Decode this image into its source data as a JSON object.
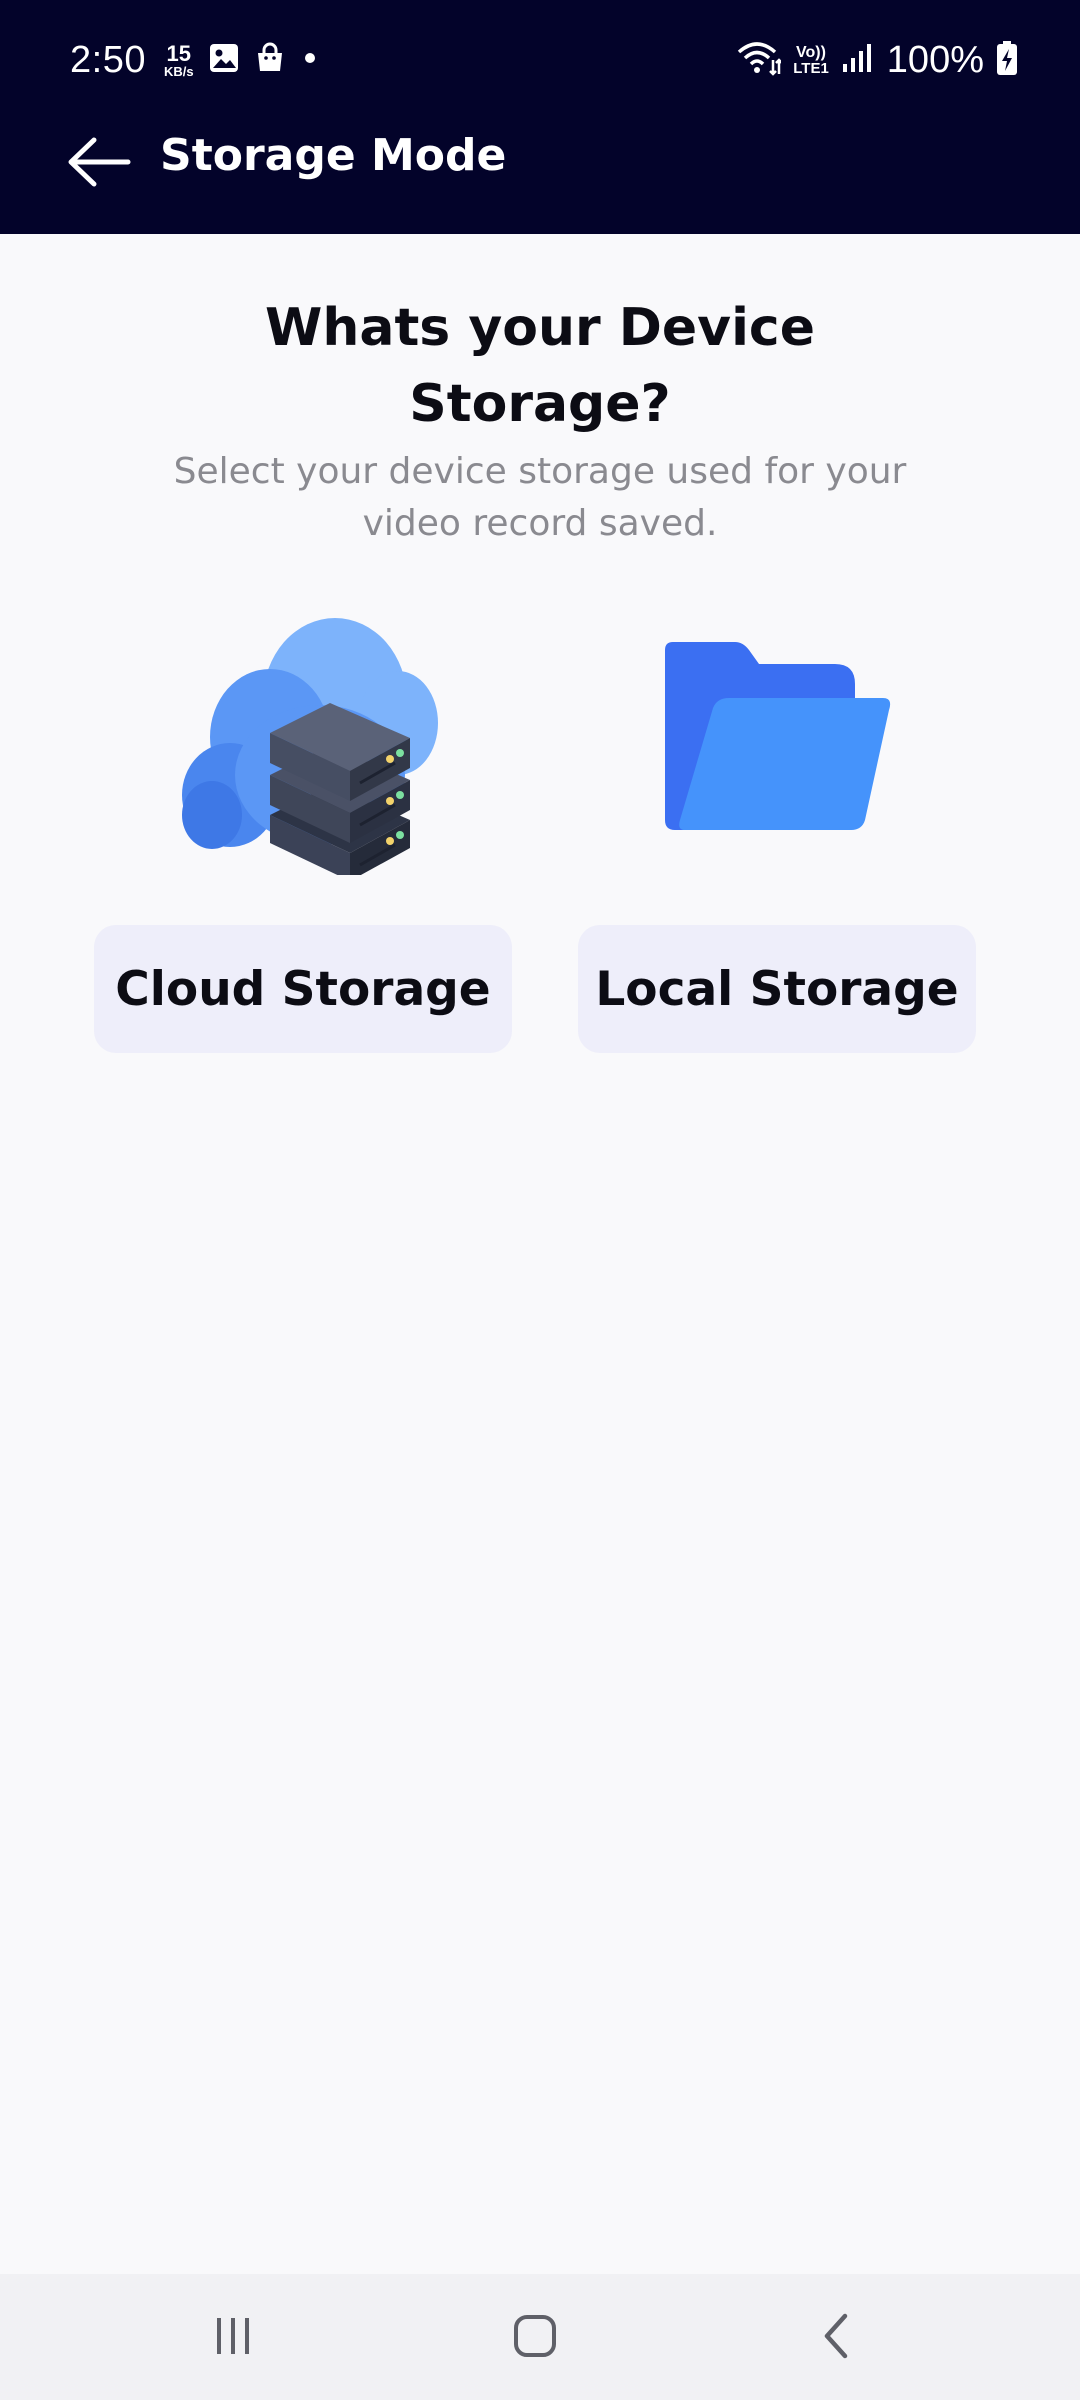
{
  "status_bar": {
    "time": "2:50",
    "speed_value": "15",
    "speed_unit": "KB/s",
    "network_top": "Vo))",
    "network_bottom": "LTE1",
    "battery": "100%"
  },
  "app_bar": {
    "title": "Storage Mode",
    "back_icon": "arrow-left-icon"
  },
  "content": {
    "heading": "Whats your Device Storage?",
    "subheading": "Select your device storage used for your video record saved.",
    "options": [
      {
        "label": "Cloud Storage",
        "icon": "cloud-server-icon"
      },
      {
        "label": "Local Storage",
        "icon": "folder-icon"
      }
    ]
  },
  "nav_bar": {
    "icons": [
      "recent-apps-icon",
      "home-icon",
      "back-icon"
    ]
  },
  "colors": {
    "top_bar": "#03032a",
    "background": "#f9f9fb",
    "option_button": "#eeeefa",
    "folder_back": "#3b6ff2",
    "folder_front": "#4593fb",
    "cloud": "#5b97f5"
  }
}
